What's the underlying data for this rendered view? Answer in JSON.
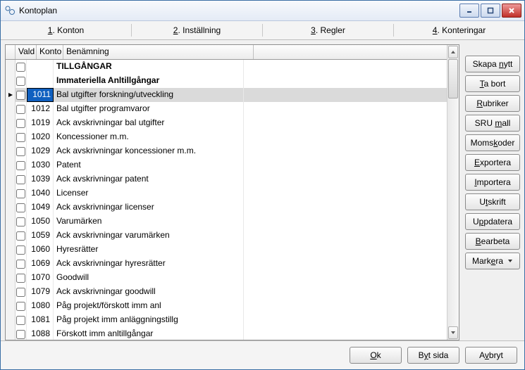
{
  "title": "Kontoplan",
  "tabs": [
    {
      "pre": "1",
      "label": ". Konton"
    },
    {
      "pre": "2",
      "label": ". Inställning"
    },
    {
      "pre": "3",
      "label": ". Regler"
    },
    {
      "pre": "4",
      "label": ". Konteringar"
    }
  ],
  "grid": {
    "columns": {
      "vald": "Vald",
      "konto": "Konto",
      "ben": "Benämning"
    },
    "rows": [
      {
        "type": "header",
        "ben": "TILLGÅNGAR"
      },
      {
        "type": "header",
        "ben": "Immateriella Anltillgångar"
      },
      {
        "type": "data",
        "konto": "1011",
        "ben": "Bal utgifter forskning/utveckling",
        "selected": true
      },
      {
        "type": "data",
        "konto": "1012",
        "ben": "Bal utgifter programvaror"
      },
      {
        "type": "data",
        "konto": "1019",
        "ben": "Ack avskrivningar bal utgifter"
      },
      {
        "type": "data",
        "konto": "1020",
        "ben": "Koncessioner m.m."
      },
      {
        "type": "data",
        "konto": "1029",
        "ben": "Ack avskrivningar koncessioner m.m."
      },
      {
        "type": "data",
        "konto": "1030",
        "ben": "Patent"
      },
      {
        "type": "data",
        "konto": "1039",
        "ben": "Ack avskrivningar patent"
      },
      {
        "type": "data",
        "konto": "1040",
        "ben": "Licenser"
      },
      {
        "type": "data",
        "konto": "1049",
        "ben": "Ack avskrivningar licenser"
      },
      {
        "type": "data",
        "konto": "1050",
        "ben": "Varumärken"
      },
      {
        "type": "data",
        "konto": "1059",
        "ben": "Ack avskrivningar varumärken"
      },
      {
        "type": "data",
        "konto": "1060",
        "ben": "Hyresrätter"
      },
      {
        "type": "data",
        "konto": "1069",
        "ben": "Ack avskrivningar hyresrätter"
      },
      {
        "type": "data",
        "konto": "1070",
        "ben": "Goodwill"
      },
      {
        "type": "data",
        "konto": "1079",
        "ben": "Ack avskrivningar goodwill"
      },
      {
        "type": "data",
        "konto": "1080",
        "ben": "Påg projekt/förskott imm anl"
      },
      {
        "type": "data",
        "konto": "1081",
        "ben": "Påg projekt imm anläggningstillg"
      },
      {
        "type": "data",
        "konto": "1088",
        "ben": "Förskott imm anltillgångar"
      }
    ]
  },
  "sideButtons": [
    {
      "pre": "Skapa ",
      "ul": "n",
      "post": "ytt"
    },
    {
      "ul": "T",
      "post": "a bort"
    },
    {
      "ul": "R",
      "post": "ubriker"
    },
    {
      "pre": "SRU ",
      "ul": "m",
      "post": "all"
    },
    {
      "pre": "Moms",
      "ul": "k",
      "post": "oder"
    },
    {
      "ul": "E",
      "post": "xportera"
    },
    {
      "ul": "I",
      "post": "mportera"
    },
    {
      "pre": "U",
      "ul": "t",
      "post": "skrift"
    },
    {
      "pre": "U",
      "ul": "p",
      "post": "pdatera"
    },
    {
      "ul": "B",
      "post": "earbeta"
    },
    {
      "pre": "Mark",
      "ul": "e",
      "post": "ra",
      "caret": true
    }
  ],
  "footer": {
    "ok": {
      "ul": "O",
      "post": "k"
    },
    "byt": {
      "pre": "B",
      "ul": "y",
      "post": "t sida"
    },
    "avbryt": {
      "pre": "A",
      "ul": "v",
      "post": "bryt"
    }
  }
}
